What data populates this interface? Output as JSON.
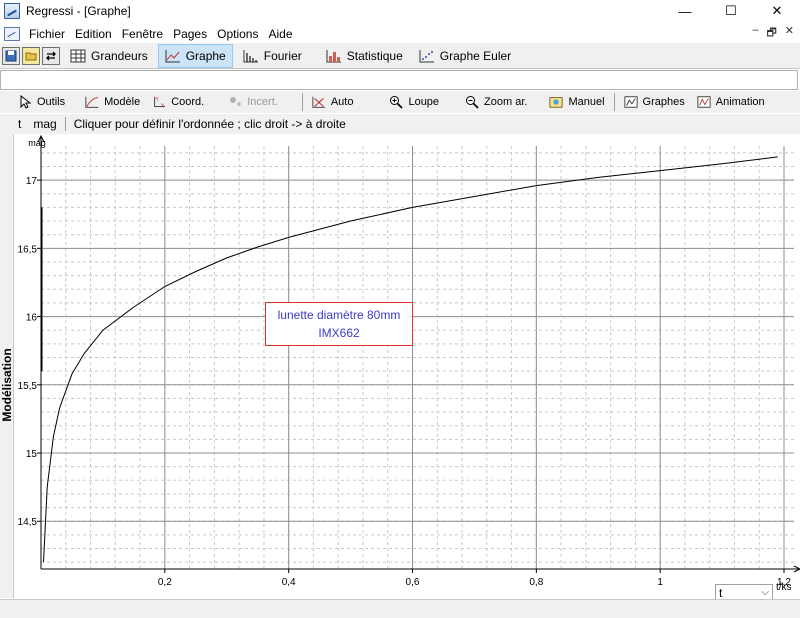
{
  "window": {
    "title": "Regressi - [Graphe]",
    "controls": {
      "minimize": "—",
      "maximize": "☐",
      "close": "✕"
    }
  },
  "menu": {
    "items": [
      "Fichier",
      "Edition",
      "Fenêtre",
      "Pages",
      "Options",
      "Aide"
    ],
    "mdi": {
      "minimize": "–",
      "restore": "🗗",
      "close": "✕"
    }
  },
  "pages": {
    "tabs": [
      {
        "label": "Grandeurs"
      },
      {
        "label": "Graphe",
        "active": true
      },
      {
        "label": "Fourier"
      },
      {
        "label": "Statistique"
      },
      {
        "label": "Graphe Euler"
      }
    ]
  },
  "toolbar": {
    "items": [
      {
        "label": "Outils",
        "icon": "cursor-icon"
      },
      {
        "label": "Modèle",
        "icon": "model-icon"
      },
      {
        "label": "Coord.",
        "icon": "coord-icon"
      },
      {
        "label": "Incert.",
        "icon": "uncertainty-icon",
        "disabled": true
      },
      {
        "label": "Auto",
        "icon": "auto-icon"
      },
      {
        "label": "Loupe",
        "icon": "magnifier-icon"
      },
      {
        "label": "Zoom ar.",
        "icon": "zoom-out-icon"
      },
      {
        "label": "Manuel",
        "icon": "manual-icon"
      },
      {
        "label": "Graphes",
        "icon": "graphs-icon"
      },
      {
        "label": "Animation",
        "icon": "animation-icon"
      }
    ]
  },
  "status": {
    "x_var": "t",
    "y_var": "mag",
    "message": "Cliquer pour définir l'ordonnée ; clic droit -> à droite"
  },
  "side_tab": {
    "label": "Modélisation"
  },
  "annotation": {
    "line1": "lunette diamètre 80mm",
    "line2": "IMX662"
  },
  "x_selector": {
    "value": "t",
    "arrow": "⌵"
  },
  "chart_data": {
    "type": "line",
    "ylabel": "mag",
    "xlabel": "t/ks",
    "xlim": [
      0,
      1.2
    ],
    "ylim": [
      14.15,
      17.25
    ],
    "x_ticks": [
      0.2,
      0.4,
      0.6,
      0.8,
      1,
      1.2
    ],
    "x_tick_labels": [
      "0,2",
      "0,4",
      "0,6",
      "0,8",
      "1",
      "1,2"
    ],
    "y_ticks": [
      14.5,
      15,
      15.5,
      16,
      16.5,
      17
    ],
    "y_tick_labels": [
      "14,5",
      "15",
      "15,5",
      "16",
      "16,5",
      "17"
    ],
    "grid": true,
    "series": [
      {
        "color": "#000000",
        "x": [
          0.004,
          0.01,
          0.02,
          0.03,
          0.05,
          0.07,
          0.1,
          0.15,
          0.2,
          0.25,
          0.3,
          0.35,
          0.4,
          0.5,
          0.6,
          0.7,
          0.8,
          0.9,
          1.0,
          1.1,
          1.19
        ],
        "y": [
          14.2,
          14.75,
          15.12,
          15.33,
          15.58,
          15.73,
          15.9,
          16.07,
          16.22,
          16.33,
          16.43,
          16.51,
          16.58,
          16.7,
          16.8,
          16.88,
          16.96,
          17.02,
          17.07,
          17.12,
          17.17
        ]
      }
    ]
  }
}
